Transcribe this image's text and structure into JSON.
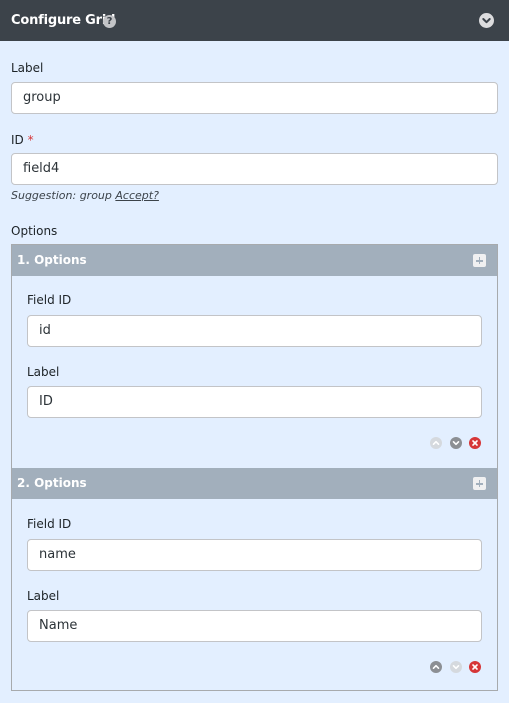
{
  "header": {
    "title": "Configure Grid",
    "help_icon": "question-circle-icon",
    "collapse_icon": "chevron-down-circle-icon"
  },
  "form": {
    "label_label": "Label",
    "label_value": "group",
    "id_label": "ID",
    "id_required_mark": "*",
    "id_value": "field4",
    "suggestion_text": "Suggestion: group",
    "suggestion_accept": "Accept?",
    "options_label": "Options"
  },
  "options": [
    {
      "title": "1. Options",
      "field_id_label": "Field ID",
      "field_id_value": "id",
      "label_label": "Label",
      "label_value": "ID"
    },
    {
      "title": "2. Options",
      "field_id_label": "Field ID",
      "field_id_value": "name",
      "label_label": "Label",
      "label_value": "Name"
    }
  ],
  "colors": {
    "header_bg": "#3c434a",
    "panel_bg": "#e3efff",
    "item_header_bg": "#a2afbc",
    "delete": "#d63638",
    "required": "#d63638"
  }
}
